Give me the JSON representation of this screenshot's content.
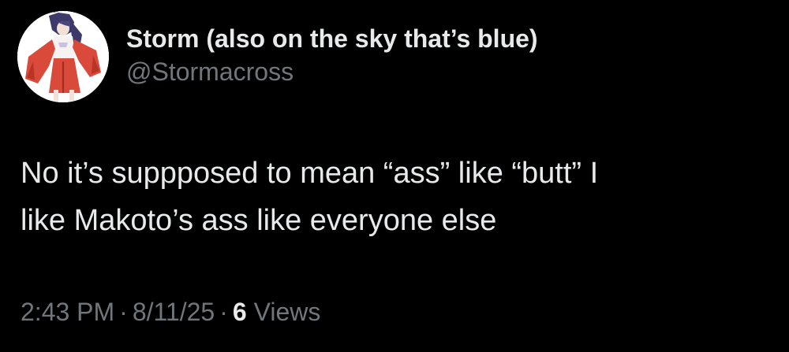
{
  "author": {
    "display_name": "Storm (also on the sky that’s blue)",
    "handle": "@Stormacross",
    "avatar_icon": "anime-character-avatar"
  },
  "post": {
    "text": "No it’s suppposed to mean “ass” like “butt” I\nlike Makoto’s ass like everyone else"
  },
  "meta": {
    "time": "2:43 PM",
    "separator": "·",
    "date": "8/11/25",
    "views_count": "6",
    "views_label": "Views"
  },
  "colors": {
    "background": "#000000",
    "primary_text": "#e7e9ea",
    "secondary_text": "#71767b"
  }
}
